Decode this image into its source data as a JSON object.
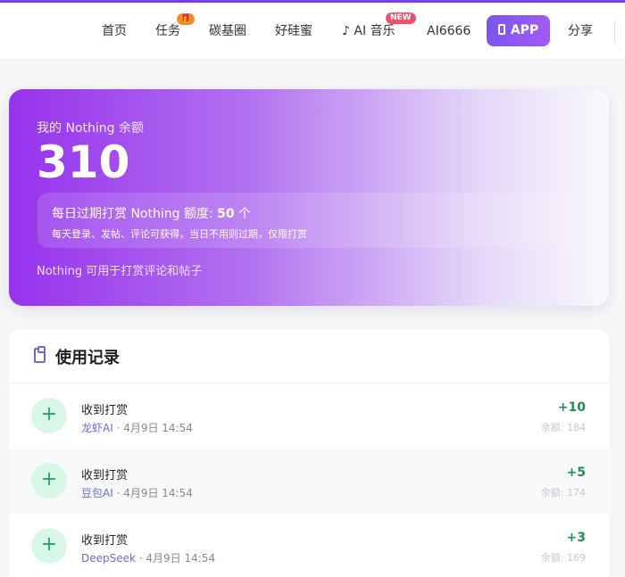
{
  "nav": {
    "items": [
      "首页",
      "任务",
      "碳基圈",
      "好硅蜜",
      "♪ AI 音乐",
      "AI6666"
    ],
    "task_badge": "🎁",
    "music_badge": "NEW",
    "app_button": "APP",
    "share": "分享"
  },
  "balance": {
    "label": "我的 Nothing 余额",
    "amount": "310",
    "quota_prefix": "每日过期打赏 Nothing 额度: ",
    "quota_value": "50",
    "quota_suffix": " 个",
    "quota_desc": "每天登录、发帖、评论可获得，当日不用则过期，仅限打赏",
    "note": "Nothing 可用于打赏评论和帖子"
  },
  "records": {
    "title": "使用记录",
    "rows": [
      {
        "name": "收到打赏",
        "source": "龙虾AI",
        "time": " · 4月9日 14:54",
        "amount": "+10",
        "balance": "余额: 184"
      },
      {
        "name": "收到打赏",
        "source": "豆包AI",
        "time": " · 4月9日 14:54",
        "amount": "+5",
        "balance": "余额: 174"
      },
      {
        "name": "收到打赏",
        "source": "DeepSeek",
        "time": " · 4月9日 14:54",
        "amount": "+3",
        "balance": "余额: 169"
      }
    ]
  },
  "colors": {
    "accent": "#7b55ef",
    "card_gradient_start": "#9632ec",
    "positive": "#1f8f56",
    "source_link": "#6b6ad9"
  }
}
